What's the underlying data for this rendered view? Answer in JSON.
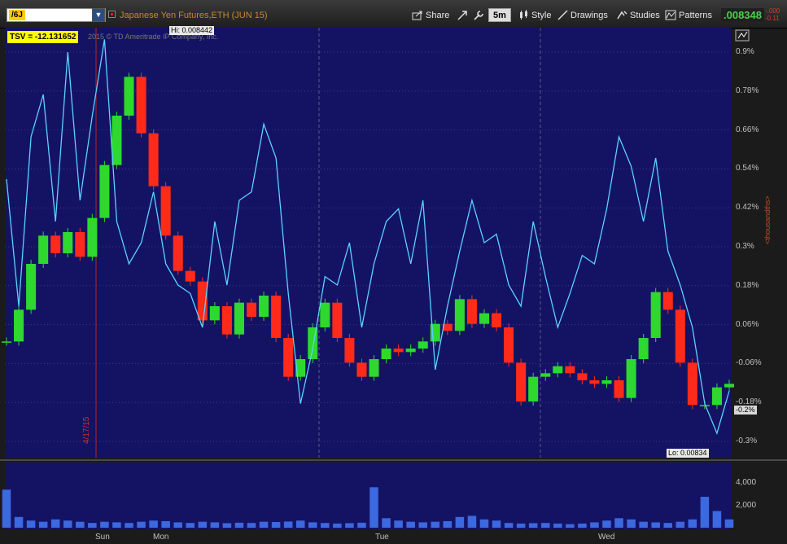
{
  "toolbar": {
    "symbol": "/6J",
    "symbol_dropdown": "▼",
    "description": "Japanese Yen Futures,ETH (JUN 15)",
    "share_label": "Share",
    "timeframe": "5m",
    "style_label": "Style",
    "drawings_label": "Drawings",
    "studies_label": "Studies",
    "patterns_label": "Patterns",
    "last_price": ".008348",
    "change_lines": [
      "-.000",
      "-0.11"
    ]
  },
  "colors": {
    "plot_background": "#141363",
    "volume_background": "#141363",
    "up_candle": "#2ed82e",
    "down_candle": "#ff2a1a",
    "indicator_line": "#5ad2ff",
    "volume_bars": "#3c68e0",
    "grid": "#3a3a80",
    "tsv_badge": "#ffff00"
  },
  "study": {
    "label": "TSV",
    "value": "= -12.131652"
  },
  "copyright": "2015 © TD Ameritrade IP Company, Inc.",
  "price_panel": {
    "hi_label": "Hi: 0.008442",
    "lo_label": "Lo: 0.00834",
    "right_axis_labels": [
      "0.9%",
      "0.78%",
      "0.66%",
      "0.54%",
      "0.42%",
      "0.3%",
      "0.18%",
      "0.06%",
      "-0.06%",
      "-0.18%",
      "-0.3%"
    ],
    "current_pct_label": "-0.2%",
    "units_label": "<thousandths>",
    "date_marker": "4/17/15"
  },
  "volume_panel": {
    "axis_labels": [
      "4,000",
      "2,000"
    ]
  },
  "time_axis": {
    "labels": [
      "Sun",
      "Mon",
      "Tue",
      "Wed"
    ]
  },
  "chart_data": {
    "type": "line",
    "series": [
      {
        "values": [
          0.008362,
          0.008371,
          0.008384,
          0.008392,
          0.008387,
          0.008393,
          0.008386,
          0.008397,
          0.008412,
          0.008426,
          0.008437,
          0.008421,
          0.008406,
          0.008392,
          0.008382,
          0.008379,
          0.008368,
          0.008372,
          0.008364,
          0.008373,
          0.008369,
          0.008375,
          0.008363,
          0.008352,
          0.008357,
          0.008366,
          0.008373,
          0.008363,
          0.008356,
          0.008352,
          0.008357,
          0.00836,
          0.008359,
          0.00836,
          0.008362,
          0.008367,
          0.008365,
          0.008374,
          0.008367,
          0.00837,
          0.008366,
          0.008356,
          0.008345,
          0.008352,
          0.008353,
          0.008355,
          0.008353,
          0.008351,
          0.00835,
          0.008351,
          0.008346,
          0.008357,
          0.008363,
          0.008376,
          0.008371,
          0.008356,
          0.008344,
          0.008344,
          0.008349,
          0.00835
        ]
      },
      {
        "name": "TSV",
        "values": [
          0.65,
          0.35,
          0.75,
          0.85,
          0.55,
          0.95,
          0.6,
          0.8,
          0.98,
          0.55,
          0.45,
          0.5,
          0.62,
          0.45,
          0.4,
          0.38,
          0.3,
          0.55,
          0.4,
          0.6,
          0.62,
          0.78,
          0.7,
          0.38,
          0.12,
          0.25,
          0.42,
          0.4,
          0.5,
          0.3,
          0.45,
          0.55,
          0.58,
          0.45,
          0.6,
          0.2,
          0.35,
          0.48,
          0.6,
          0.5,
          0.52,
          0.4,
          0.35,
          0.55,
          0.42,
          0.3,
          0.38,
          0.47,
          0.45,
          0.58,
          0.75,
          0.68,
          0.55,
          0.7,
          0.48,
          0.4,
          0.3,
          0.12,
          0.05,
          0.15
        ]
      }
    ],
    "volume": [
      3200,
      900,
      600,
      500,
      700,
      600,
      500,
      400,
      500,
      450,
      400,
      500,
      600,
      550,
      450,
      400,
      500,
      450,
      380,
      420,
      400,
      500,
      480,
      520,
      600,
      450,
      400,
      350,
      380,
      420,
      3400,
      800,
      600,
      500,
      450,
      500,
      550,
      900,
      1000,
      700,
      600,
      400,
      350,
      380,
      400,
      350,
      300,
      350,
      450,
      600,
      800,
      700,
      500,
      450,
      400,
      500,
      700,
      2600,
      1400,
      700
    ],
    "ylim": [
      0.00833,
      0.00845
    ],
    "volume_ylim": [
      0,
      5200
    ],
    "grid": true
  }
}
